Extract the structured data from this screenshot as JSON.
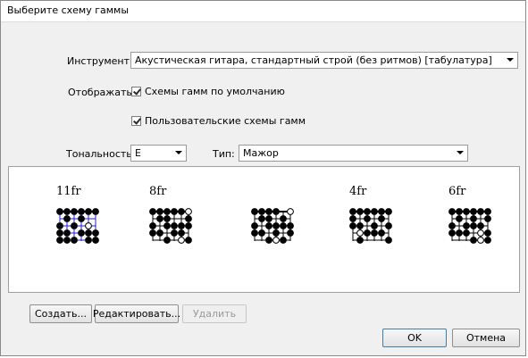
{
  "window": {
    "title": "Выберите схему гаммы"
  },
  "instrument": {
    "label": "Инструмент:",
    "value": "Акустическая гитара, стандартный строй (без ритмов) [табулатура]"
  },
  "display": {
    "label": "Отображать:",
    "default_scales": {
      "label": "Схемы гамм по умолчанию",
      "checked": true
    },
    "user_scales": {
      "label": "Пользовательские схемы гамм",
      "checked": true
    }
  },
  "tonality": {
    "label": "Тональность:",
    "value": "E"
  },
  "type": {
    "label": "Тип:",
    "value": "Мажор"
  },
  "scales": [
    {
      "fret": "11fr",
      "selected": true,
      "dots": [
        [
          0,
          0
        ],
        [
          0,
          1
        ],
        [
          0,
          2
        ],
        [
          0,
          3
        ],
        [
          0,
          4
        ],
        [
          0,
          5
        ],
        [
          1,
          1
        ],
        [
          1,
          3
        ],
        [
          2,
          0
        ],
        [
          2,
          2
        ],
        [
          2,
          4
        ],
        [
          3,
          0
        ],
        [
          3,
          1
        ],
        [
          3,
          3
        ],
        [
          3,
          4
        ],
        [
          3,
          5
        ],
        [
          4,
          0
        ],
        [
          4,
          1
        ],
        [
          4,
          2
        ],
        [
          4,
          4
        ],
        [
          4,
          5
        ]
      ],
      "open": [
        [
          2,
          4
        ]
      ]
    },
    {
      "fret": "8fr",
      "selected": false,
      "dots": [
        [
          0,
          0
        ],
        [
          0,
          1
        ],
        [
          0,
          2
        ],
        [
          0,
          3
        ],
        [
          0,
          4
        ],
        [
          0,
          5
        ],
        [
          1,
          1
        ],
        [
          1,
          2
        ],
        [
          1,
          5
        ],
        [
          2,
          0
        ],
        [
          2,
          2
        ],
        [
          2,
          3
        ],
        [
          2,
          4
        ],
        [
          2,
          5
        ],
        [
          3,
          0
        ],
        [
          3,
          1
        ],
        [
          3,
          3
        ],
        [
          3,
          4
        ],
        [
          4,
          2
        ],
        [
          4,
          4
        ],
        [
          4,
          5
        ]
      ],
      "open": [
        [
          4,
          4
        ],
        [
          0,
          5
        ]
      ]
    },
    {
      "fret": "",
      "selected": false,
      "dots": [
        [
          0,
          0
        ],
        [
          0,
          1
        ],
        [
          0,
          2
        ],
        [
          0,
          3
        ],
        [
          0,
          5
        ],
        [
          1,
          1
        ],
        [
          1,
          2
        ],
        [
          1,
          4
        ],
        [
          2,
          0
        ],
        [
          2,
          2
        ],
        [
          2,
          3
        ],
        [
          2,
          4
        ],
        [
          2,
          5
        ],
        [
          3,
          0
        ],
        [
          3,
          1
        ],
        [
          3,
          3
        ],
        [
          3,
          5
        ],
        [
          4,
          2
        ],
        [
          4,
          3
        ],
        [
          4,
          4
        ]
      ],
      "open": [
        [
          0,
          5
        ],
        [
          4,
          3
        ]
      ]
    },
    {
      "fret": "4fr",
      "selected": false,
      "dots": [
        [
          0,
          0
        ],
        [
          0,
          1
        ],
        [
          0,
          2
        ],
        [
          0,
          3
        ],
        [
          0,
          4
        ],
        [
          0,
          5
        ],
        [
          1,
          0
        ],
        [
          1,
          2
        ],
        [
          1,
          4
        ],
        [
          2,
          0
        ],
        [
          2,
          1
        ],
        [
          2,
          3
        ],
        [
          2,
          5
        ],
        [
          3,
          1
        ],
        [
          3,
          2
        ],
        [
          3,
          3
        ],
        [
          3,
          4
        ],
        [
          4,
          1
        ],
        [
          4,
          5
        ]
      ],
      "open": [
        [
          3,
          1
        ]
      ]
    },
    {
      "fret": "6fr",
      "selected": false,
      "dots": [
        [
          0,
          0
        ],
        [
          0,
          1
        ],
        [
          0,
          2
        ],
        [
          0,
          3
        ],
        [
          0,
          4
        ],
        [
          0,
          5
        ],
        [
          1,
          1
        ],
        [
          1,
          3
        ],
        [
          1,
          5
        ],
        [
          2,
          0
        ],
        [
          2,
          2
        ],
        [
          2,
          3
        ],
        [
          2,
          4
        ],
        [
          3,
          0
        ],
        [
          3,
          1
        ],
        [
          3,
          2
        ],
        [
          3,
          4
        ],
        [
          3,
          5
        ],
        [
          4,
          3
        ],
        [
          4,
          4
        ],
        [
          4,
          5
        ]
      ],
      "open": [
        [
          3,
          4
        ],
        [
          4,
          4
        ]
      ]
    }
  ],
  "buttons": {
    "create": "Создать...",
    "edit": "Редактировать...",
    "delete": "Удалить",
    "ok": "OK",
    "cancel": "Отмена"
  },
  "colors": {
    "selected": "#2020d0",
    "dot": "#000000",
    "open_dot": "#ffffff"
  }
}
